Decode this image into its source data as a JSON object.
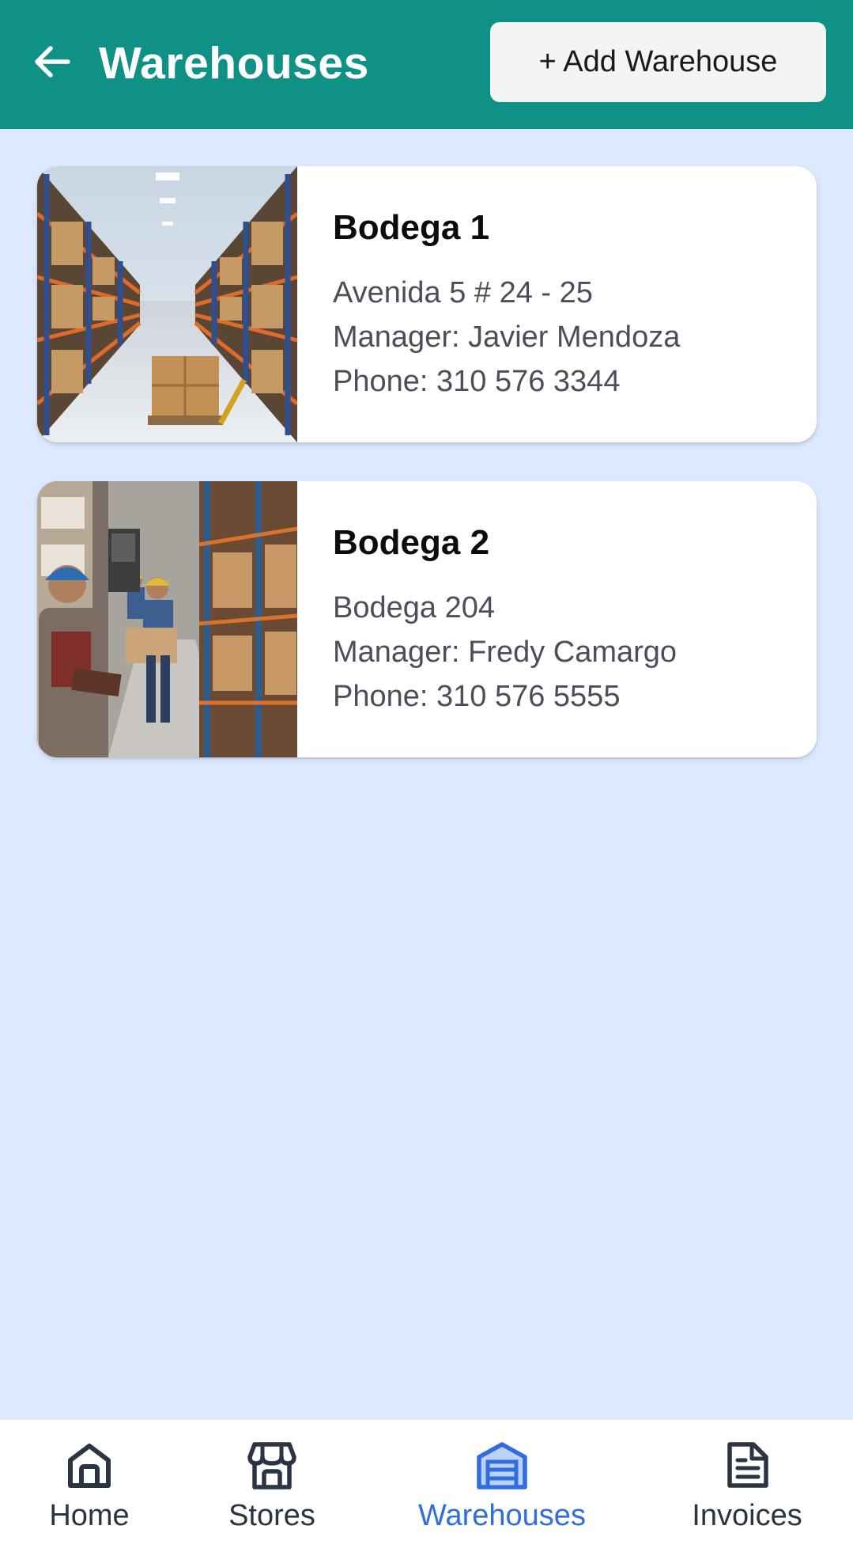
{
  "header": {
    "title": "Warehouses",
    "back_icon": "arrow-left-icon",
    "add_button_label": "+ Add Warehouse",
    "background_color": "#0f9185"
  },
  "warehouses": [
    {
      "name": "Bodega 1",
      "address": "Avenida 5 # 24 - 25",
      "manager": "Manager: Javier Mendoza",
      "phone": "Phone: 310 576 3344",
      "image": "warehouse-aisle-photo"
    },
    {
      "name": "Bodega 2",
      "address": "Bodega 204",
      "manager": "Manager: Fredy Camargo",
      "phone": "Phone: 310 576 5555",
      "image": "warehouse-workers-photo"
    }
  ],
  "bottom_nav": {
    "items": [
      {
        "label": "Home",
        "icon": "home-icon",
        "active": false
      },
      {
        "label": "Stores",
        "icon": "store-icon",
        "active": false
      },
      {
        "label": "Warehouses",
        "icon": "warehouse-icon",
        "active": true
      },
      {
        "label": "Invoices",
        "icon": "invoice-icon",
        "active": false
      }
    ],
    "active_color": "#2f6de0"
  },
  "page_background": "#dbe8fd"
}
